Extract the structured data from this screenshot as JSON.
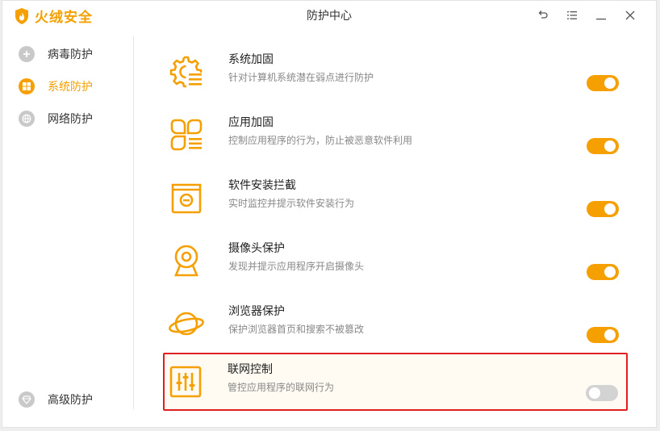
{
  "app": {
    "name": "火绒安全",
    "title": "防护中心",
    "accent": "#f5a000",
    "highlight_border": "#e02020"
  },
  "window_controls": [
    {
      "name": "back-icon"
    },
    {
      "name": "menu-icon"
    },
    {
      "name": "minimize-icon"
    },
    {
      "name": "close-icon"
    }
  ],
  "sidebar": {
    "items": [
      {
        "label": "病毒防护",
        "icon": "virus-shield-icon",
        "active": false
      },
      {
        "label": "系统防护",
        "icon": "windows-icon",
        "active": true
      },
      {
        "label": "网络防护",
        "icon": "globe-icon",
        "active": false
      }
    ],
    "bottom": {
      "label": "高级防护",
      "icon": "diamond-icon"
    }
  },
  "items": [
    {
      "title": "系统加固",
      "desc": "针对计算机系统潜在弱点进行防护",
      "icon": "gear-list-icon",
      "enabled": true
    },
    {
      "title": "应用加固",
      "desc": "控制应用程序的行为，防止被恶意软件利用",
      "icon": "apps-icon",
      "enabled": true
    },
    {
      "title": "软件安装拦截",
      "desc": "实时监控并提示软件安装行为",
      "icon": "install-box-icon",
      "enabled": true
    },
    {
      "title": "摄像头保护",
      "desc": "发现并提示应用程序开启摄像头",
      "icon": "camera-icon",
      "enabled": true
    },
    {
      "title": "浏览器保护",
      "desc": "保护浏览器首页和搜索不被篡改",
      "icon": "planet-icon",
      "enabled": true
    },
    {
      "title": "联网控制",
      "desc": "管控应用程序的联网行为",
      "icon": "sliders-icon",
      "enabled": false
    }
  ]
}
